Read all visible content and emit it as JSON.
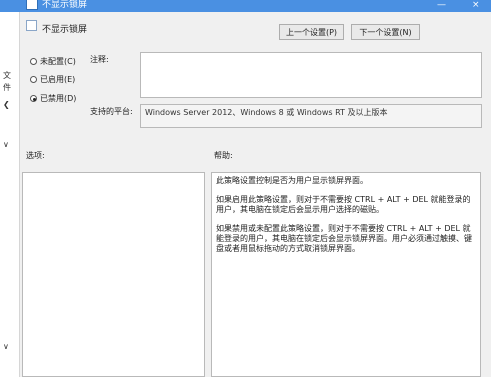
{
  "window": {
    "title": "不显示锁屏",
    "minimize": "—",
    "close": "×"
  },
  "leftstrip": {
    "items": [
      "文",
      "件",
      "❮",
      "∨",
      "∨"
    ]
  },
  "header": {
    "policy_name": "不显示锁屏",
    "prev_button": "上一个设置(P)",
    "next_button": "下一个设置(N)"
  },
  "options": [
    {
      "label": "未配置(C)",
      "selected": false
    },
    {
      "label": "已启用(E)",
      "selected": false
    },
    {
      "label": "已禁用(D)",
      "selected": true
    }
  ],
  "labels": {
    "comment": "注释:",
    "supported": "支持的平台:",
    "options": "选项:",
    "help": "帮助:"
  },
  "supported_text": "Windows Server 2012、Windows 8 或 Windows RT 及以上版本",
  "help": {
    "paragraphs": [
      "此策略设置控制是否为用户显示锁屏界面。",
      "如果启用此策略设置，则对于不需要按 CTRL + ALT + DEL 就能登录的用户，其电脑在锁定后会显示用户选择的磁贴。",
      "如果禁用或未配置此策略设置，则对于不需要按 CTRL + ALT + DEL 就能登录的用户，其电脑在锁定后会显示锁屏界面。用户必须通过触摸、键盘或者用鼠标拖动的方式取消锁屏界面。"
    ]
  }
}
